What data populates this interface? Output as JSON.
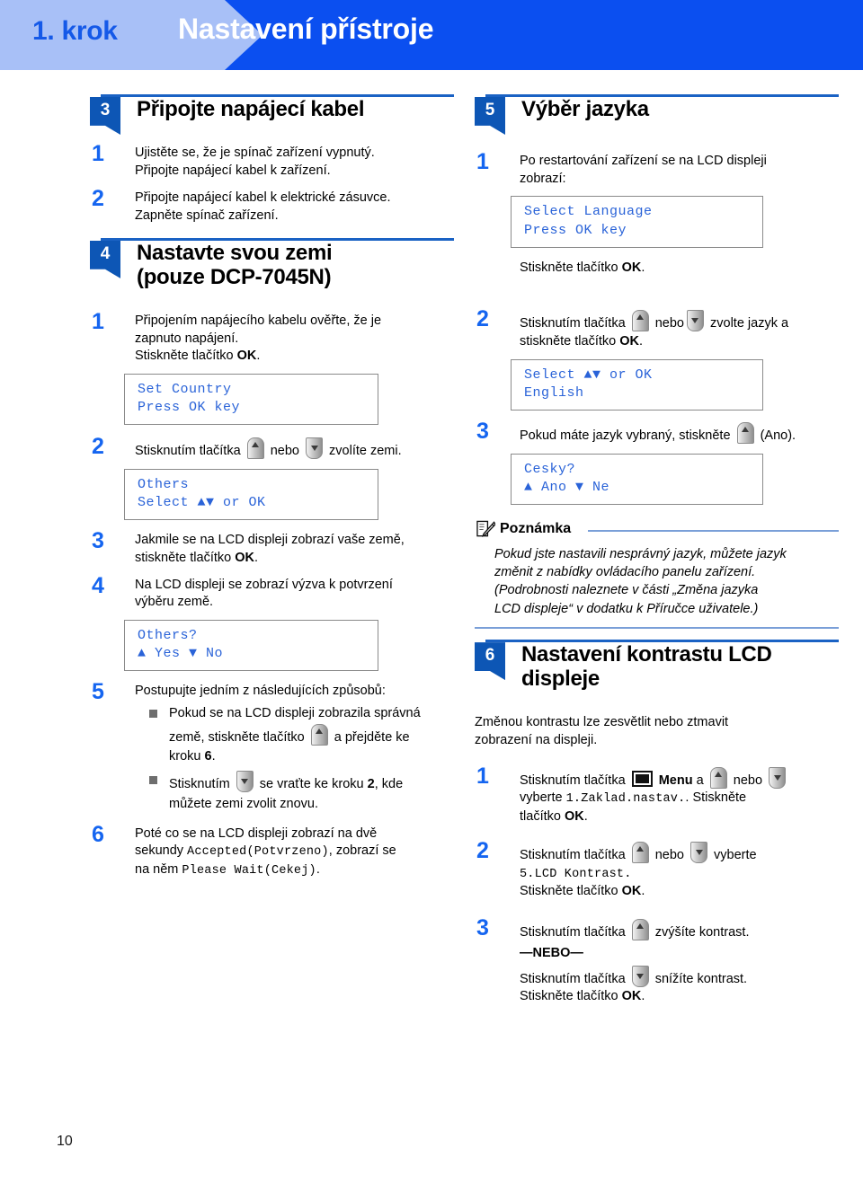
{
  "header": {
    "step_badge": "1. krok",
    "title": "Nastavení přístroje"
  },
  "page_number": "10",
  "colors": {
    "header_band": "#0b4ff0",
    "header_badge": "#a8c0f7",
    "step_number": "#1565f0",
    "section_badge": "#0d56b5",
    "lcd_text": "#2a63d8",
    "rule": "#1a62c4",
    "note_rule": "#7a9fd8"
  },
  "left_column": {
    "section3": {
      "number": "3",
      "title": "Připojte napájecí kabel",
      "steps": [
        {
          "number": "1",
          "line1": "Ujistěte se, že je spínač zařízení vypnutý.",
          "line2": "Připojte napájecí kabel k zařízení."
        },
        {
          "number": "2",
          "line1": "Připojte napájecí kabel k elektrické zásuvce.",
          "line2": "Zapněte spínač zařízení."
        }
      ]
    },
    "section4": {
      "number": "4",
      "title_line1": "Nastavte svou zemi",
      "title_line2": "(pouze DCP-7045N)",
      "step1": {
        "number": "1",
        "line1": "Připojením napájecího kabelu ověřte, že je",
        "line2": "zapnuto napájení.",
        "line3_prefix": "Stiskněte tlačítko ",
        "line3_bold": "OK",
        "line3_suffix": ".",
        "lcd_line1": "Set Country",
        "lcd_line2": "Press OK key"
      },
      "step2": {
        "number": "2",
        "text_before": "Stisknutím tlačítka",
        "text_middle": "nebo",
        "text_after": "zvolíte zemi.",
        "lcd_line1": "Others",
        "lcd_line2": "Select ▲▼ or OK"
      },
      "step3": {
        "number": "3",
        "line1": "Jakmile se na LCD displeji zobrazí vaše země,",
        "line2_prefix": "stiskněte tlačítko ",
        "line2_bold": "OK",
        "line2_suffix": "."
      },
      "step4": {
        "number": "4",
        "line1": "Na LCD displeji se zobrazí výzva k potvrzení",
        "line2": "výběru země.",
        "lcd_line1": "Others?",
        "lcd_line2": "▲ Yes ▼ No"
      },
      "step5": {
        "number": "5",
        "intro": "Postupujte jedním z následujících způsobů:",
        "bullet1_a": "Pokud se na LCD displeji zobrazila správná",
        "bullet1_b": "země, stiskněte tlačítko",
        "bullet1_c": "a přejděte ke",
        "bullet1_d": "kroku ",
        "bullet1_bold": "6",
        "bullet1_e": ".",
        "bullet2_a": "Stisknutím",
        "bullet2_b": "se vraťte ke kroku ",
        "bullet2_bold": "2",
        "bullet2_c": ", kde",
        "bullet2_d": "můžete zemi zvolit znovu."
      },
      "step6": {
        "number": "6",
        "line1": "Poté co se na LCD displeji zobrazí na dvě",
        "line2_prefix": "sekundy ",
        "line2_mono": "Accepted(Potvrzeno)",
        "line2_suffix": ", zobrazí se",
        "line3_prefix": "na něm ",
        "line3_mono": "Please Wait(Cekej)",
        "line3_suffix": "."
      }
    }
  },
  "right_column": {
    "section5": {
      "number": "5",
      "title": "Výběr jazyka",
      "step1": {
        "number": "1",
        "line1": "Po restartování zařízení se na LCD displeji",
        "line2": "zobrazí:",
        "lcd_line1": "Select Language",
        "lcd_line2": "Press OK key",
        "after_prefix": "Stiskněte tlačítko ",
        "after_bold": "OK",
        "after_suffix": "."
      },
      "step2": {
        "number": "2",
        "text_before": "Stisknutím tlačítka",
        "text_middle": "nebo",
        "text_after": "zvolte jazyk a",
        "line2_prefix": "stiskněte tlačítko ",
        "line2_bold": "OK",
        "line2_suffix": ".",
        "lcd_line1": "Select ▲▼ or OK",
        "lcd_line2": "English"
      },
      "step3": {
        "number": "3",
        "text_before": "Pokud máte jazyk vybraný, stiskněte",
        "text_after": "(Ano).",
        "lcd_line1": "Cesky?",
        "lcd_line2": "▲ Ano ▼ Ne"
      },
      "note": {
        "title": "Poznámka",
        "line1": "Pokud jste nastavili nesprávný jazyk, můžete jazyk",
        "line2": "změnit z nabídky ovládacího panelu zařízení.",
        "line3": "(Podrobnosti naleznete v části „Změna jazyka",
        "line4": "LCD displeje“ v dodatku k Příručce uživatele.)"
      }
    },
    "section6": {
      "number": "6",
      "title_line1": "Nastavení kontrastu LCD",
      "title_line2": "displeje",
      "intro_line1": "Změnou kontrastu lze zesvětlit nebo ztmavit",
      "intro_line2": "zobrazení na displeji.",
      "step1": {
        "number": "1",
        "text_before": "Stisknutím tlačítka",
        "menu_label": "Menu",
        "text_a": "a",
        "text_middle": "nebo",
        "line2_prefix": "vyberte ",
        "line2_mono": "1.Zaklad.nastav.",
        "line2_suffix": ". Stiskněte",
        "line3_prefix": "tlačítko ",
        "line3_bold": "OK",
        "line3_suffix": "."
      },
      "step2": {
        "number": "2",
        "text_before": "Stisknutím tlačítka",
        "text_middle": "nebo",
        "text_after": "vyberte",
        "line2_mono": "5.LCD Kontrast.",
        "line3_prefix": "Stiskněte tlačítko ",
        "line3_bold": "OK",
        "line3_suffix": "."
      },
      "step3": {
        "number": "3",
        "text_before": "Stisknutím tlačítka",
        "text_after": "zvýšíte kontrast.",
        "or_label": "—NEBO—",
        "line2_before": "Stisknutím tlačítka",
        "line2_after": "snížíte kontrast.",
        "line3_prefix": "Stiskněte tlačítko ",
        "line3_bold": "OK",
        "line3_suffix": "."
      }
    }
  },
  "icons": {
    "key_up": "arrow-up-key-icon",
    "key_down": "arrow-down-key-icon",
    "menu": "menu-key-icon",
    "note": "note-pencil-icon"
  }
}
